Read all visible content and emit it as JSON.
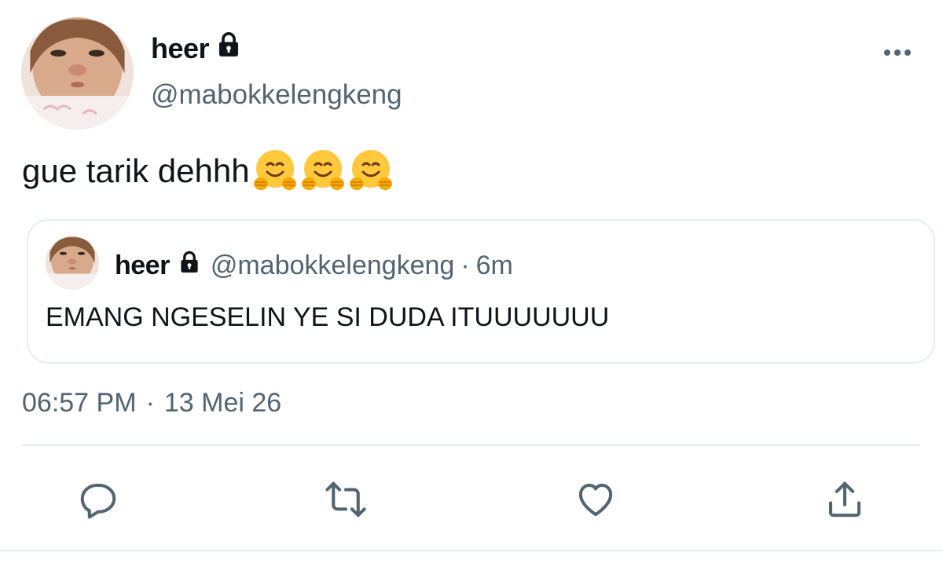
{
  "tweet": {
    "author": {
      "display_name": "heer",
      "handle": "@mabokkelengkeng",
      "protected_icon": "lock-icon",
      "avatar": "profile-photo"
    },
    "text": "gue tarik dehhh",
    "emoji": [
      "hugging-face",
      "hugging-face",
      "hugging-face"
    ],
    "time": "06:57 PM",
    "separator": "·",
    "date": "13 Mei 26"
  },
  "quoted_tweet": {
    "display_name": "heer",
    "handle": "@mabokkelengkeng",
    "separator": "·",
    "time_ago": "6m",
    "text": "EMANG NGESELIN YE SI DUDA ITUUUUUUU"
  },
  "actions": {
    "icons": [
      "reply-icon",
      "retweet-icon",
      "like-icon",
      "share-icon"
    ]
  },
  "colors": {
    "text_primary": "#0f1419",
    "text_secondary": "#536471",
    "border": "#e6ecf0",
    "icon": "#536471"
  }
}
